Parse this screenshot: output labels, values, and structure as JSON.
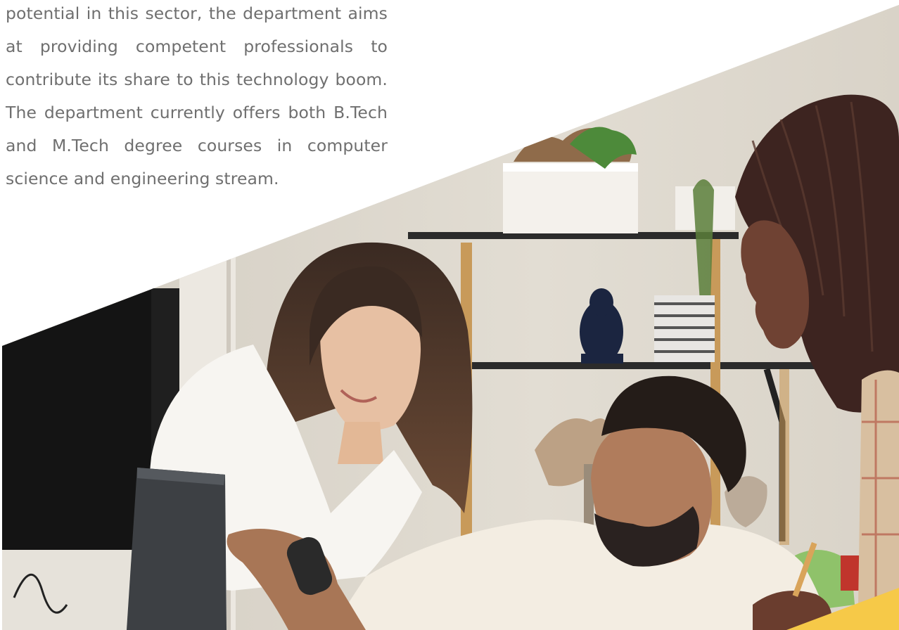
{
  "intro": {
    "lines": [
      "potential in this sector, the department aims",
      "at providing competent professionals to",
      "contribute its share to this technology boom.",
      "The department currently offers both B.Tech",
      "and M.Tech degree courses in computer",
      "science and engineering stream."
    ]
  },
  "photo": {
    "subject": "three-people-collaborating-at-laptop"
  },
  "colors": {
    "body_text": "#6f6f6f",
    "accent_yellow": "#f6c948",
    "page_background": "#ffffff"
  }
}
